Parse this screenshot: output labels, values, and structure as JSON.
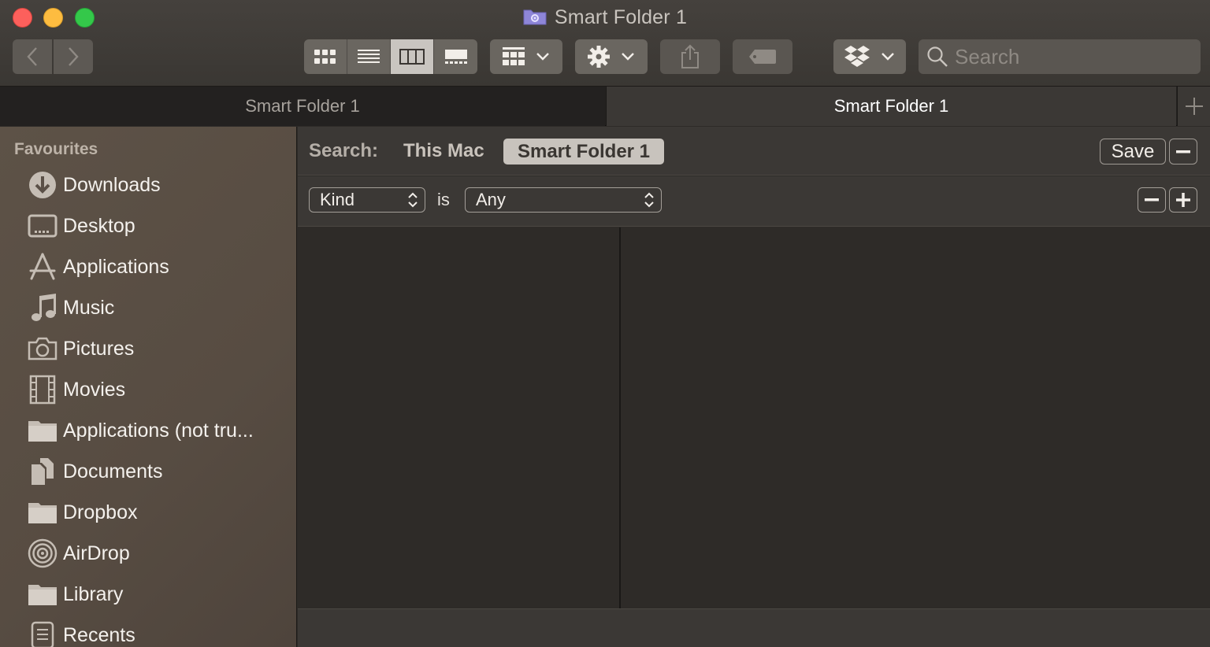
{
  "window": {
    "title": "Smart Folder 1"
  },
  "toolbar": {
    "search_placeholder": "Search",
    "view_modes": [
      "icons",
      "list",
      "columns",
      "gallery"
    ],
    "active_view": "columns"
  },
  "tabs": [
    {
      "label": "Smart Folder 1",
      "active": false
    },
    {
      "label": "Smart Folder 1",
      "active": true
    }
  ],
  "sidebar": {
    "header": "Favourites",
    "items": [
      {
        "label": "Downloads",
        "icon": "downloads-icon"
      },
      {
        "label": "Desktop",
        "icon": "desktop-icon"
      },
      {
        "label": "Applications",
        "icon": "applications-icon"
      },
      {
        "label": "Music",
        "icon": "music-icon"
      },
      {
        "label": "Pictures",
        "icon": "camera-icon"
      },
      {
        "label": "Movies",
        "icon": "film-icon"
      },
      {
        "label": "Applications (not tru...",
        "icon": "folder-icon"
      },
      {
        "label": "Documents",
        "icon": "documents-icon"
      },
      {
        "label": "Dropbox",
        "icon": "folder-icon"
      },
      {
        "label": "AirDrop",
        "icon": "airdrop-icon"
      },
      {
        "label": "Library",
        "icon": "folder-icon"
      },
      {
        "label": "Recents",
        "icon": "recents-icon"
      }
    ]
  },
  "search_bar": {
    "label": "Search:",
    "scope_this_mac": "This Mac",
    "scope_active": "Smart Folder 1",
    "save_label": "Save"
  },
  "criteria": {
    "attribute": "Kind",
    "operator": "is",
    "value": "Any"
  },
  "colors": {
    "close": "#fc605c",
    "minimize": "#fdbc40",
    "zoom": "#34c84a"
  }
}
